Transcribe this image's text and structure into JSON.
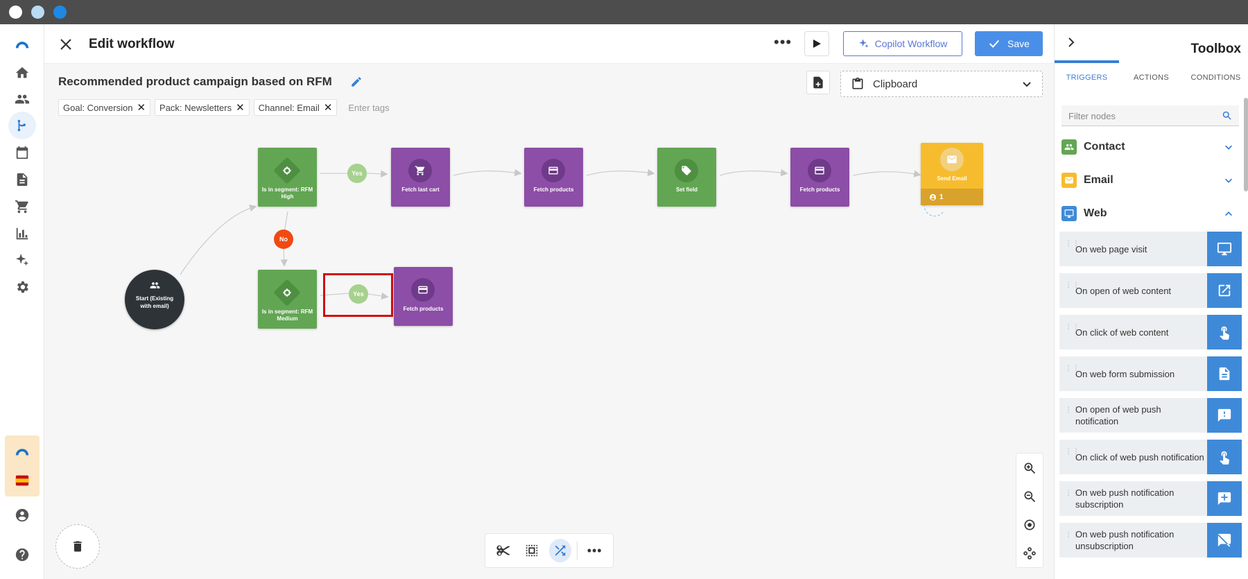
{
  "os": {
    "dot_colors": [
      "#ffffff",
      "#b9dcf4",
      "#1e88e5"
    ]
  },
  "header": {
    "title": "Edit workflow",
    "copilot_label": "Copilot Workflow",
    "save_label": "Save"
  },
  "workflow": {
    "name": "Recommended product campaign based on RFM",
    "tags": [
      "Goal: Conversion",
      "Pack: Newsletters",
      "Channel: Email"
    ],
    "tag_placeholder": "Enter tags",
    "clipboard_label": "Clipboard"
  },
  "canvas": {
    "start": {
      "label": "Start (Existing with email)"
    },
    "nodes": {
      "seg_high": "Is in segment: RFM High",
      "fetch_cart": "Fetch last cart",
      "fetch_products_1": "Fetch products",
      "set_field": "Set field",
      "fetch_products_2": "Fetch products",
      "send_email": "Send Email",
      "send_email_count": "1",
      "seg_medium": "Is in segment: RFM Medium",
      "fetch_products_3": "Fetch products"
    },
    "yes_label": "Yes",
    "no_label": "No"
  },
  "toolbox": {
    "title": "Toolbox",
    "tabs": [
      "TRIGGERS",
      "ACTIONS",
      "CONDITIONS"
    ],
    "filter_placeholder": "Filter nodes",
    "categories": [
      {
        "label": "Contact",
        "color": "#62a653"
      },
      {
        "label": "Email",
        "color": "#f7bc2e"
      },
      {
        "label": "Web",
        "color": "#3f8ad8"
      }
    ],
    "items": [
      {
        "label": "On web page visit",
        "icon": "monitor-icon"
      },
      {
        "label": "On open of web content",
        "icon": "open-external-icon"
      },
      {
        "label": "On click of web content",
        "icon": "touch-icon"
      },
      {
        "label": "On web form submission",
        "icon": "document-icon"
      },
      {
        "label": "On open of web push notification",
        "icon": "alert-message-icon"
      },
      {
        "label": "On click of web push notification",
        "icon": "touch-icon"
      },
      {
        "label": "On web push notification subscription",
        "icon": "add-message-icon"
      },
      {
        "label": "On web push notification unsubscription",
        "icon": "cancel-message-icon"
      }
    ]
  },
  "colors": {
    "accent": "#4a8fe7",
    "green": "#62a653",
    "purple": "#8c4ea6",
    "yellow": "#f7bc2e",
    "highlight": "#d10d0d"
  }
}
